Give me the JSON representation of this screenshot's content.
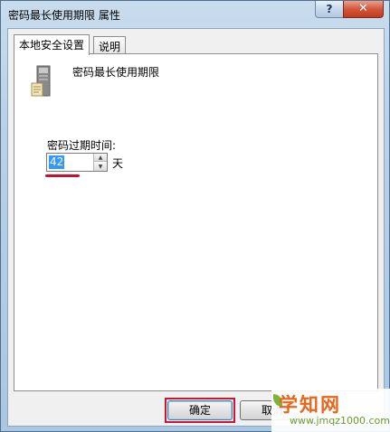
{
  "window": {
    "title": "密码最长使用期限 属性",
    "help_label": "?",
    "close_label": "✕"
  },
  "tabs": [
    {
      "label": "本地安全设置",
      "active": true
    },
    {
      "label": "说明",
      "active": false
    }
  ],
  "policy": {
    "icon": "server-icon",
    "name": "密码最长使用期限"
  },
  "password_expiry": {
    "label": "密码过期时间:",
    "value": "42",
    "unit": "天"
  },
  "buttons": {
    "ok_label": "确定",
    "cancel_label": "取消"
  },
  "watermark": {
    "main": "学知网",
    "sub": "www.jmqz1000.com"
  },
  "colors": {
    "highlight_red": "#d0142c",
    "selection_blue": "#3399ff",
    "watermark_orange": "#e8661a"
  }
}
